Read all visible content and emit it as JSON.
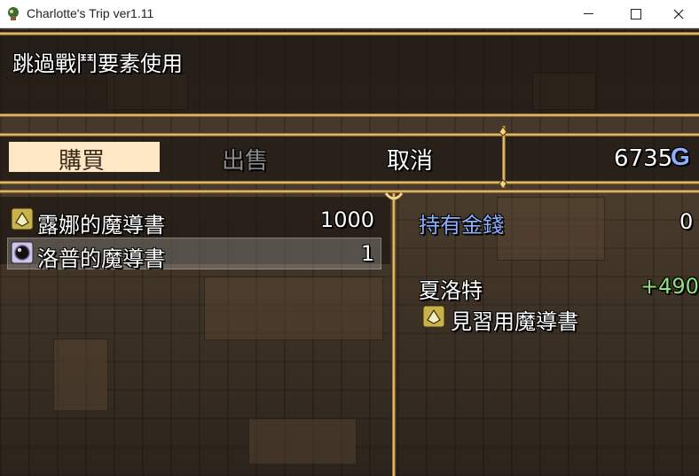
{
  "window": {
    "title": "Charlotte's Trip ver1.11",
    "controls": [
      "minimize",
      "maximize",
      "close"
    ]
  },
  "message": "跳過戰鬥要素使用",
  "commands": {
    "buy": "購買",
    "sell": "出售",
    "cancel": "取消"
  },
  "gold": {
    "amount": "6735",
    "unit": "G"
  },
  "items": [
    {
      "icon": "book-icon",
      "name": "露娜的魔導書",
      "price": "1000"
    },
    {
      "icon": "orb-icon",
      "name": "洛普的魔導書",
      "price": "1"
    }
  ],
  "selected_item": 1,
  "status": {
    "owned_label": "持有金錢",
    "owned_value": "0",
    "character": "夏洛特",
    "delta": "+490",
    "equip_name": "見習用魔導書"
  },
  "colors": {
    "highlight_command": "#fde7c4",
    "system_blue": "#8ab0ff",
    "up_green": "#8ee07a",
    "gold_trim": "#f3d58a"
  }
}
